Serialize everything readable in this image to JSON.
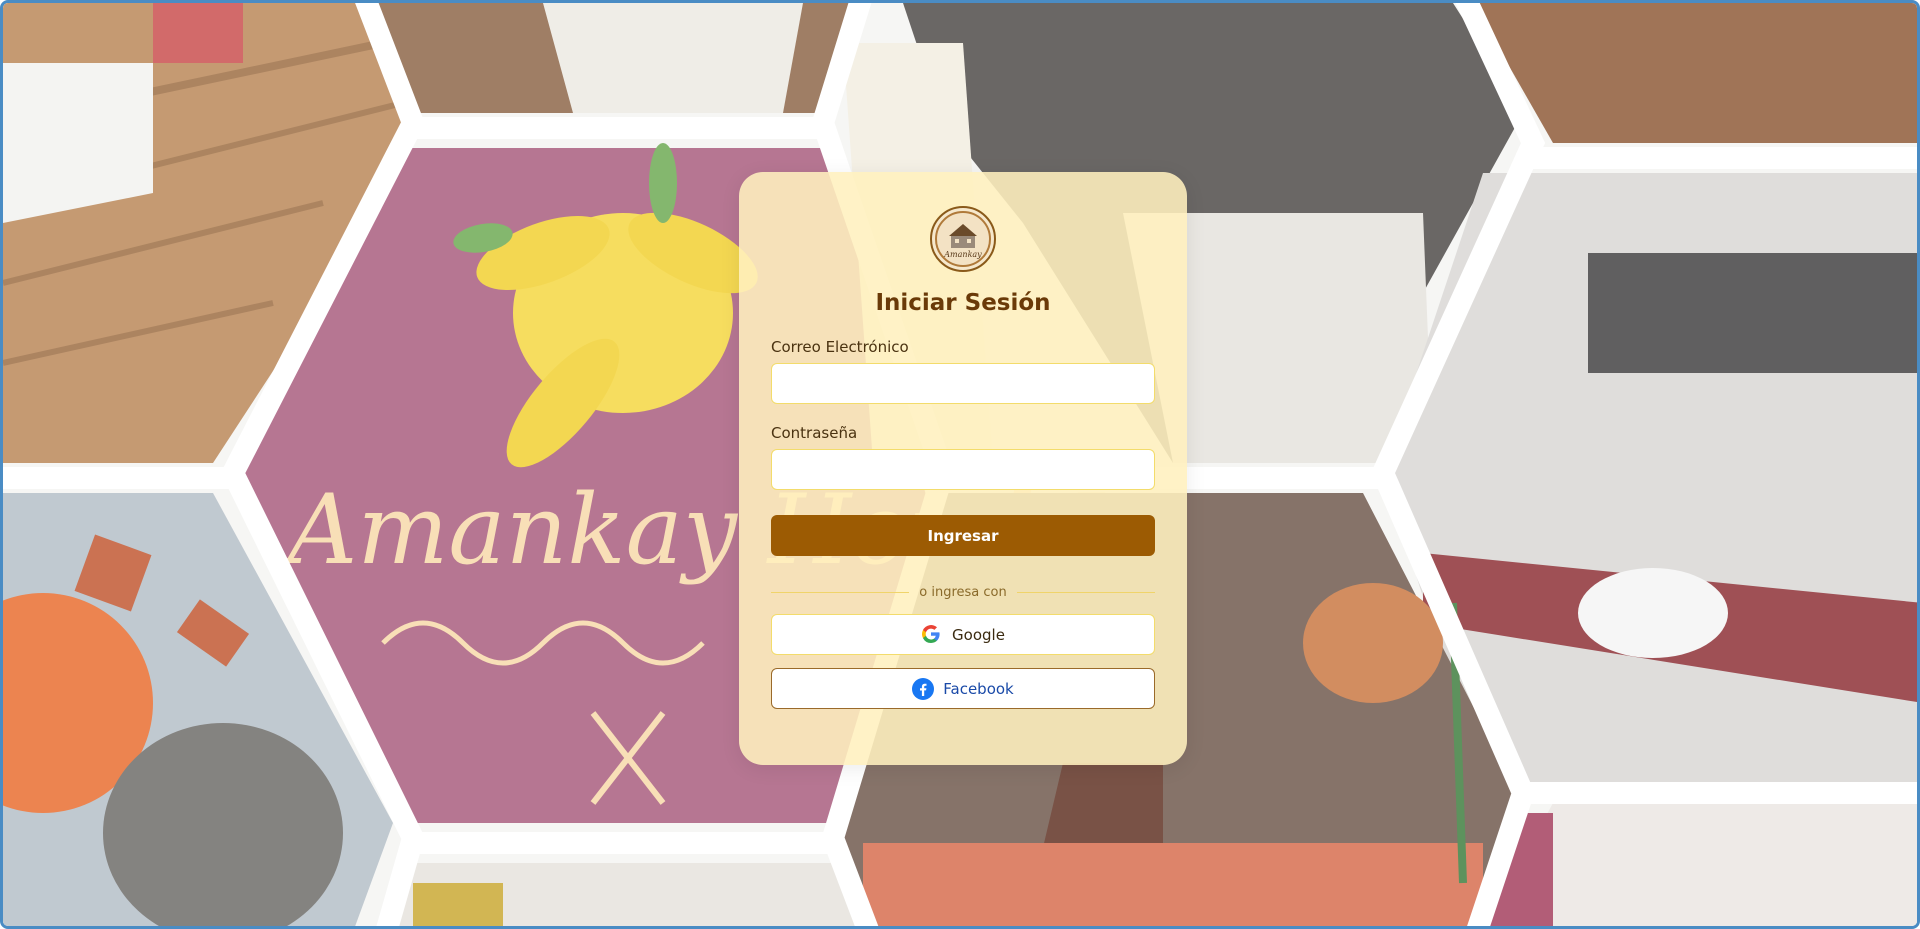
{
  "background": {
    "brand_text": "Amankay Hotel Inn"
  },
  "login": {
    "logo_text": "Amankay",
    "title": "Iniciar Sesión",
    "email_label": "Correo Electrónico",
    "email_value": "",
    "password_label": "Contraseña",
    "password_value": "",
    "submit_label": "Ingresar",
    "divider_text": "o ingresa con",
    "google_label": "Google",
    "facebook_label": "Facebook"
  },
  "colors": {
    "title": "#6a3a08",
    "primary_button": "#9c5b03",
    "card_background": "#fff0be",
    "input_border": "#f3dc6b",
    "facebook": "#1877f2"
  },
  "icons": [
    "hotel-logo-icon",
    "google-icon",
    "facebook-icon"
  ]
}
